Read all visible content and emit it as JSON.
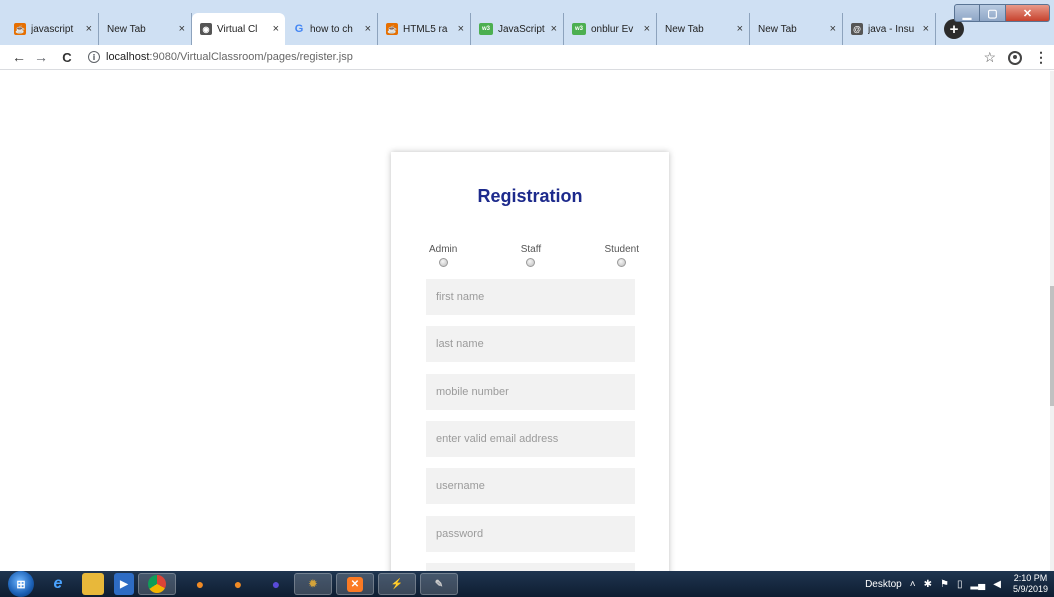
{
  "browser": {
    "tabs": [
      {
        "title": "javascript",
        "favicon": "java-icon",
        "active": false
      },
      {
        "title": "New Tab",
        "favicon": "",
        "active": false
      },
      {
        "title": "Virtual Cl",
        "favicon": "globe-icon",
        "active": true
      },
      {
        "title": "how to ch",
        "favicon": "google-icon",
        "active": false
      },
      {
        "title": "HTML5 ra",
        "favicon": "java-icon",
        "active": false
      },
      {
        "title": "JavaScript",
        "favicon": "w3schools-icon",
        "active": false
      },
      {
        "title": "onblur Ev",
        "favicon": "w3schools-icon",
        "active": false
      },
      {
        "title": "New Tab",
        "favicon": "",
        "active": false
      },
      {
        "title": "New Tab",
        "favicon": "",
        "active": false
      },
      {
        "title": "java - Insu",
        "favicon": "at-icon",
        "active": false
      }
    ],
    "tab_close_glyph": "×",
    "new_tab_glyph": "+",
    "address": {
      "host": "localhost",
      "path": ":9080/VirtualClassroom/pages/register.jsp"
    }
  },
  "page": {
    "title": "Registration",
    "title_color": "#1d2a8c",
    "roles": [
      {
        "label": "Admin"
      },
      {
        "label": "Staff"
      },
      {
        "label": "Student"
      }
    ],
    "fields": [
      {
        "placeholder": "first name"
      },
      {
        "placeholder": "last name"
      },
      {
        "placeholder": "mobile number"
      },
      {
        "placeholder": "enter valid email address"
      },
      {
        "placeholder": "username"
      },
      {
        "placeholder": "password"
      },
      {
        "placeholder": ""
      }
    ]
  },
  "taskbar": {
    "desktop_label": "Desktop",
    "time": "2:10 PM",
    "date": "5/9/2019"
  }
}
